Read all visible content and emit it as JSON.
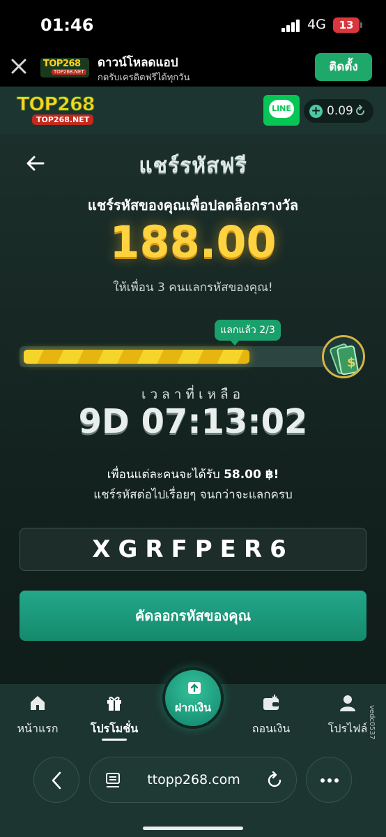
{
  "status_bar": {
    "time": "01:46",
    "network": "4G",
    "battery": "13"
  },
  "banner": {
    "title": "ดาวน์โหลดแอป",
    "subtitle": "กดรับเครดิตฟรีได้ทุกวัน",
    "install_label": "ติดตั้ง",
    "logo_text": "TOP268",
    "logo_url": "TOP268.NET"
  },
  "header": {
    "logo_text": "TOP268",
    "logo_url": "TOP268.NET",
    "line_label": "LINE",
    "balance": "0.09"
  },
  "page": {
    "title": "แชร์รหัสฟรี",
    "subtitle": "แชร์รหัสของคุณเพื่อปลดล็อกรางวัล",
    "reward": "188.00",
    "invite_text": "ให้เพื่อน 3 คนแลกรหัสของคุณ!",
    "progress_label": "แลกแล้ว 2/3",
    "progress_fraction": 0.6667,
    "time_label": "เวลาที่เหลือ",
    "countdown": "9D 07:13:02",
    "earn_prefix": "เพื่อนแต่ละคนจะได้รับ ",
    "earn_amount": "58.00 ฿!",
    "keep_text": "แชร์รหัสต่อไปเรื่อยๆ จนกว่าจะแลกครบ",
    "code": "XGRFPER6",
    "copy_label": "คัดลอกรหัสของคุณ"
  },
  "nav": {
    "home": "หน้าแรก",
    "promotions": "โปรโมชั่น",
    "deposit": "ฝากเงิน",
    "withdraw": "ถอนเงิน",
    "profile": "โปรไฟล์",
    "side_ref": "vedc0537"
  },
  "browser": {
    "url": "ttopp268.com"
  },
  "colors": {
    "accent_green": "#1ea96a",
    "gold": "#ffd23f",
    "background": "#0f1f1c",
    "line_green": "#06c755"
  }
}
